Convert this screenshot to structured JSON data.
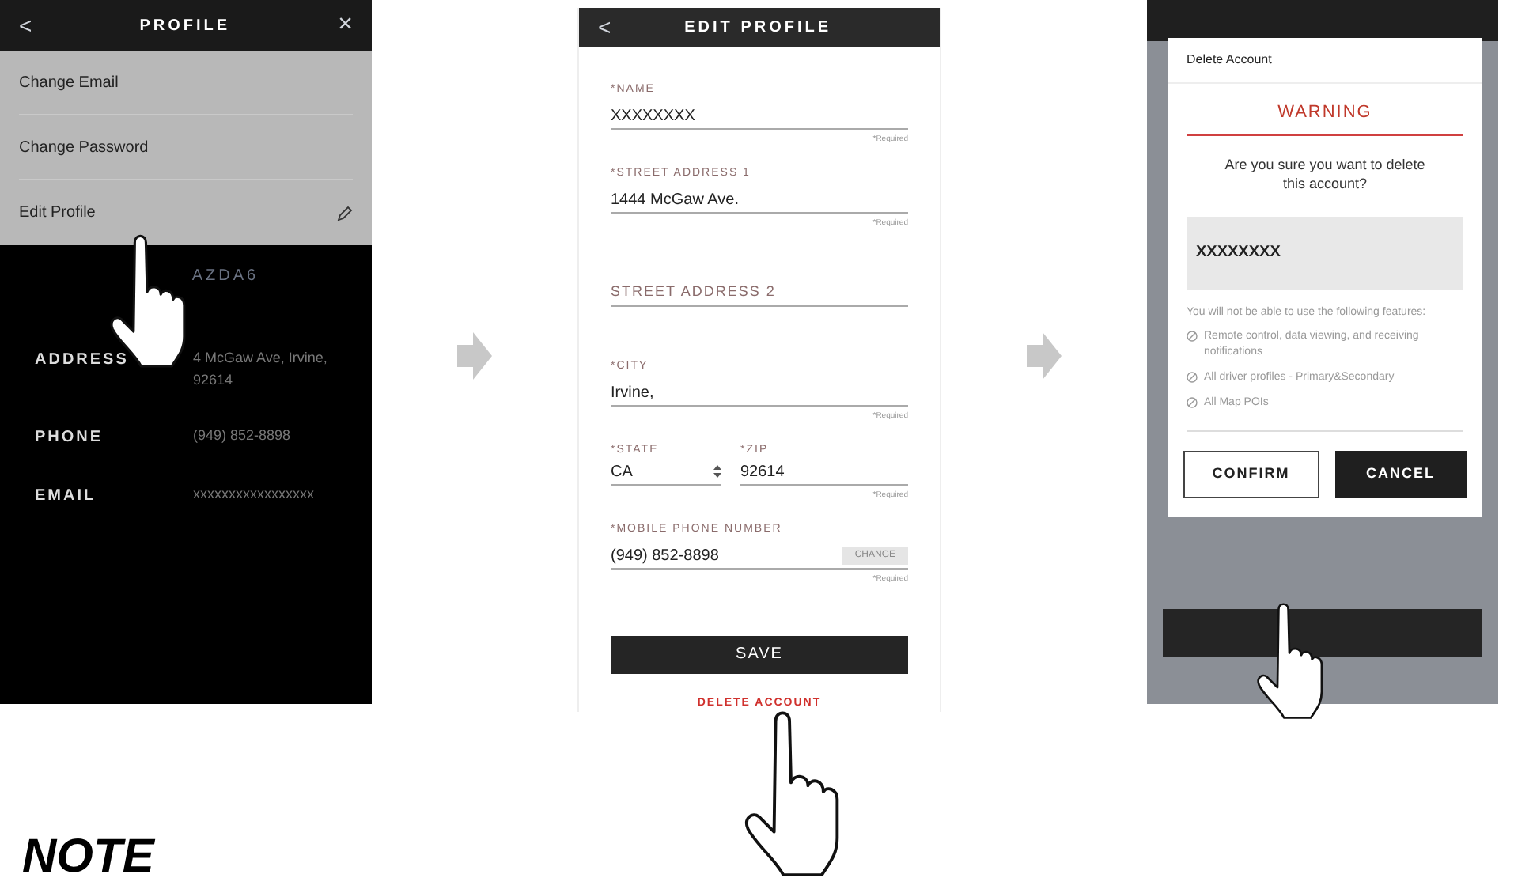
{
  "screens": [
    {
      "kind": "profile",
      "header": {
        "back": "<",
        "title": "PROFILE",
        "close": "×"
      },
      "menu": [
        {
          "label": "Change Email",
          "editable": false
        },
        {
          "label": "Change Password",
          "editable": false
        },
        {
          "label": "Edit Profile",
          "editable": true
        }
      ],
      "vehicle": "AZDA6",
      "details": [
        {
          "label": "ADDRESS",
          "lines": [
            "4 McGaw Ave, Irvine,",
            "92614"
          ]
        },
        {
          "label": "PHONE",
          "lines": [
            "(949) 852-8898"
          ]
        },
        {
          "label": "EMAIL",
          "lines": [
            "xxxxxxxxxxxxxxxxx"
          ]
        }
      ]
    },
    {
      "kind": "edit",
      "header": {
        "back": "<",
        "title": "EDIT PROFILE"
      },
      "fields": [
        {
          "kind": "text",
          "label": "*NAME",
          "value": "XXXXXXXX",
          "note": "*Required"
        },
        {
          "kind": "text",
          "label": "*STREET ADDRESS 1",
          "value": "1444 McGaw Ave.",
          "note": "*Required"
        },
        {
          "kind": "blank",
          "placeholder": "STREET ADDRESS 2"
        },
        {
          "kind": "text",
          "label": "*CITY",
          "value": "Irvine,",
          "note": "*Required"
        },
        {
          "kind": "pair",
          "items": [
            {
              "label": "*STATE",
              "value": "CA",
              "select": true
            },
            {
              "label": "*ZIP",
              "value": "92614",
              "select": false
            }
          ],
          "note": "*Required"
        },
        {
          "kind": "action",
          "label": "*MOBILE PHONE NUMBER",
          "value": "(949) 852-8898",
          "action": "CHANGE",
          "note": "*Required"
        }
      ],
      "save": "SAVE",
      "delete": "DELETE ACCOUNT"
    },
    {
      "kind": "dialog",
      "dialog": {
        "title": "Delete Account",
        "heading": "WARNING",
        "question": "Are you sure you want to delete this account?",
        "account": "XXXXXXXX",
        "intro": "You will not be able to use the following features:",
        "features": [
          "Remote control, data viewing, and receiving notifications",
          "All driver profiles - Primary&Secondary",
          "All Map POIs"
        ],
        "buttons": [
          {
            "label": "CONFIRM",
            "kind": "outline"
          },
          {
            "label": "CANCEL",
            "kind": "solid"
          }
        ]
      }
    }
  ],
  "note_heading": "NOTE"
}
